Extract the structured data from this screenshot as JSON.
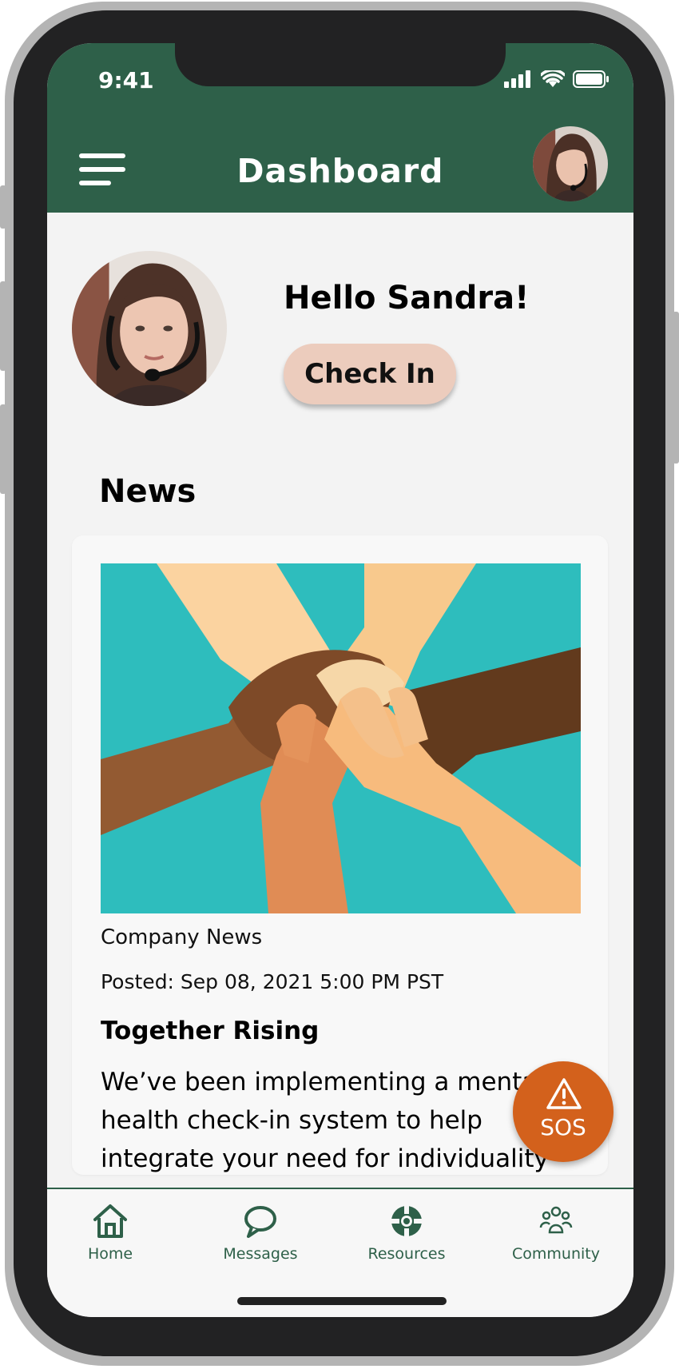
{
  "status_bar": {
    "time": "9:41"
  },
  "header": {
    "title": "Dashboard",
    "menu_icon": "hamburger-menu-icon",
    "avatar": "profile-avatar"
  },
  "greeting": {
    "text": "Hello Sandra!",
    "check_in_label": "Check In"
  },
  "news": {
    "heading": "News",
    "article": {
      "category": "Company News",
      "posted": "Posted: Sep 08, 2021 5:00 PM PST",
      "headline": "Together Rising",
      "body": "We’ve been implementing a mental health check-in system to help integrate your need for individuality"
    }
  },
  "sos": {
    "label": "SOS",
    "icon": "warning-triangle-icon",
    "color": "#d3611c"
  },
  "nav": {
    "items": [
      {
        "label": "Home",
        "icon": "home-icon"
      },
      {
        "label": "Messages",
        "icon": "chat-bubble-icon"
      },
      {
        "label": "Resources",
        "icon": "lifebuoy-icon"
      },
      {
        "label": "Community",
        "icon": "community-icon"
      }
    ]
  },
  "colors": {
    "brand_green": "#2e6049",
    "check_in_bg": "#ecccbd",
    "image_bg": "#2ebdbd"
  }
}
